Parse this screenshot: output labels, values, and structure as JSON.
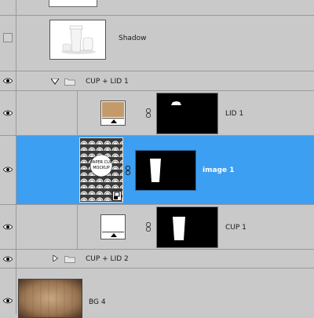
{
  "layers": {
    "shadow": {
      "name": "Shadow"
    },
    "group1": {
      "name": "CUP + LID 1"
    },
    "lid1": {
      "name": "LID 1",
      "fill_color": "#c39a69"
    },
    "image1": {
      "name": "image 1",
      "label_text": "PAPER CUP MOCKUP"
    },
    "cup1": {
      "name": "CUP 1"
    },
    "group2": {
      "name": "CUP + LID 2"
    },
    "bg4": {
      "name": "BG 4"
    }
  },
  "colors": {
    "selection": "#3d9ff1",
    "panel": "#c9c9c9"
  }
}
